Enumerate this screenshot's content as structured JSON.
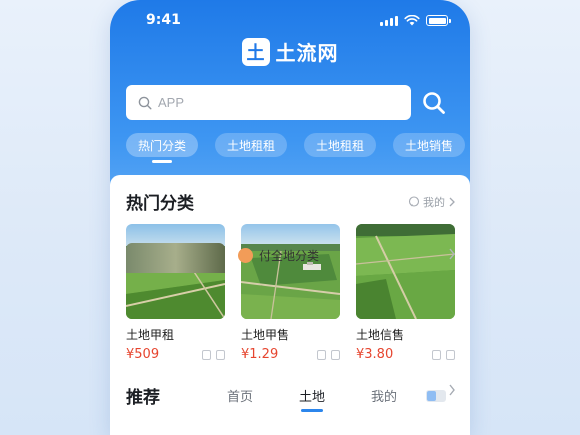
{
  "status_bar": {
    "time": "9:41"
  },
  "brand": {
    "logo_char": "土",
    "name": "土流网"
  },
  "search": {
    "placeholder": "APP"
  },
  "category_tabs": [
    {
      "label": "热门分类",
      "active": true
    },
    {
      "label": "土地租租",
      "active": false
    },
    {
      "label": "土地租租",
      "active": false
    },
    {
      "label": "土地销售",
      "active": false
    }
  ],
  "hot_section": {
    "title": "热门分类",
    "more_label": "我的",
    "items": [
      {
        "title": "土地甲租",
        "price": "¥509"
      },
      {
        "title": "土地甲售",
        "price": "¥1.29"
      },
      {
        "title": "土地信售",
        "price": "¥3.80"
      }
    ]
  },
  "recommend": {
    "title": "推荐",
    "tabs": [
      {
        "label": "首页",
        "active": false
      },
      {
        "label": "土地",
        "active": true
      },
      {
        "label": "我的",
        "active": false
      }
    ],
    "list_item_label": "付全地分类"
  },
  "colors": {
    "primary_blue": "#1f7ae8",
    "price_red": "#e6452f",
    "accent_orange": "#f29c58"
  }
}
